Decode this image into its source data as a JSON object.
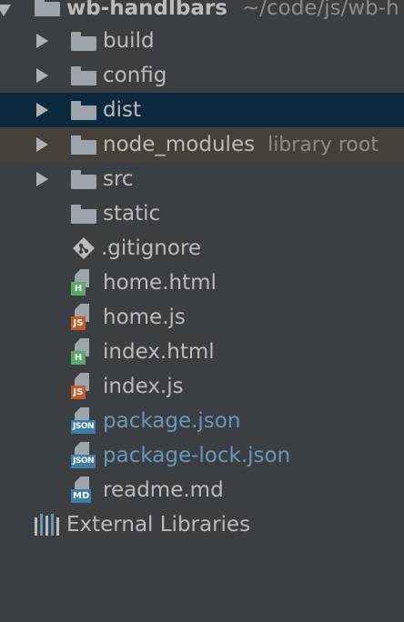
{
  "project": {
    "name": "wb-handlbars",
    "path": "~/code/js/wb-h"
  },
  "items": [
    {
      "label": "build",
      "type": "folder"
    },
    {
      "label": "config",
      "type": "folder"
    },
    {
      "label": "dist",
      "type": "folder",
      "state": "selected"
    },
    {
      "label": "node_modules",
      "type": "folder",
      "hint": "library root",
      "state": "highlight"
    },
    {
      "label": "src",
      "type": "folder"
    },
    {
      "label": "static",
      "type": "folder"
    },
    {
      "label": ".gitignore",
      "type": "git",
      "icon": "git-icon"
    },
    {
      "label": "home.html",
      "type": "file",
      "badge": "H",
      "badge_color": "#59a869"
    },
    {
      "label": "home.js",
      "type": "file",
      "badge": "JS",
      "badge_color": "#c75a2a"
    },
    {
      "label": "index.html",
      "type": "file",
      "badge": "H",
      "badge_color": "#59a869"
    },
    {
      "label": "index.js",
      "type": "file",
      "badge": "JS",
      "badge_color": "#c75a2a"
    },
    {
      "label": "package.json",
      "type": "file",
      "badge": "JSON",
      "badge_color": "#3d7da8",
      "modified": true
    },
    {
      "label": "package-lock.json",
      "type": "file",
      "badge": "JSON",
      "badge_color": "#3d7da8",
      "modified": true
    },
    {
      "label": "readme.md",
      "type": "file",
      "badge": "MD",
      "badge_color": "#3d7da8"
    }
  ],
  "external_libraries": {
    "label": "External Libraries",
    "icon": "library-icon"
  },
  "colors": {
    "background": "#3c3f41",
    "selected_row": "#0d293e",
    "highlight_row": "#45403a",
    "text": "#bbbbbb",
    "modified_text": "#6897bb"
  }
}
